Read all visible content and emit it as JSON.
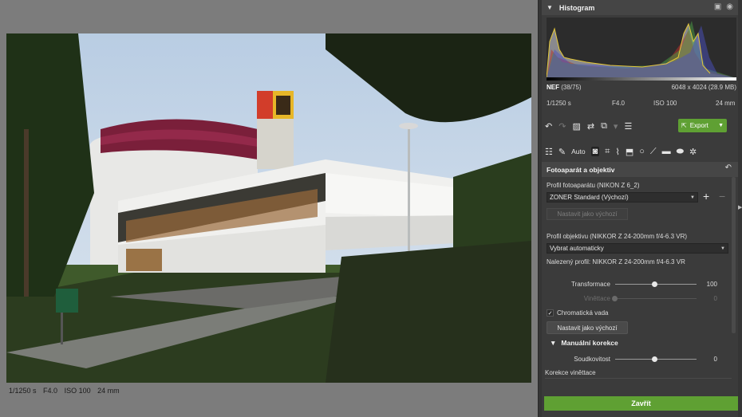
{
  "viewer": {
    "info": [
      "1/1250 s",
      "F4.0",
      "ISO 100",
      "24 mm"
    ]
  },
  "histogram": {
    "title": "Histogram",
    "file_type": "NEF",
    "file_index": "(38/75)",
    "dimensions": "6048 x 4024 (28.9 MB)",
    "exposure": "1/1250 s",
    "aperture": "F4.0",
    "iso": "ISO 100",
    "focal": "24 mm"
  },
  "toolbar": {
    "export_label": "Export",
    "auto_label": "Auto"
  },
  "section": {
    "title": "Fotoaparát a objektiv",
    "camera_profile_label": "Profil fotoaparátu (NIKON Z 6_2)",
    "camera_profile_value": "ZONER Standard (Výchozí)",
    "set_default_disabled": "Nastavit jako výchozí",
    "lens_profile_label": "Profil objektivu (NIKKOR Z 24-200mm f/4-6.3 VR)",
    "lens_profile_value": "Vybrat automaticky",
    "found_profile": "Nalezený profil: NIKKOR Z 24-200mm f/4-6.3 VR",
    "transform_label": "Transformace",
    "transform_value": "100",
    "transform_level": 1.0,
    "vignette_label": "Viněttace",
    "vignette_value": "0",
    "chromatic_label": "Chromatická vada",
    "chromatic_checked": true,
    "set_default_label": "Nastavit jako výchozí",
    "manual_label": "Manuální korekce",
    "barrel_label": "Soudkovitost",
    "barrel_value": "0",
    "vignette_corr_label": "Korekce viněttace"
  },
  "footer": {
    "close_label": "Zavřít"
  },
  "colors": {
    "accent_green": "#5fa033",
    "panel_bg": "#3b3b3b"
  }
}
